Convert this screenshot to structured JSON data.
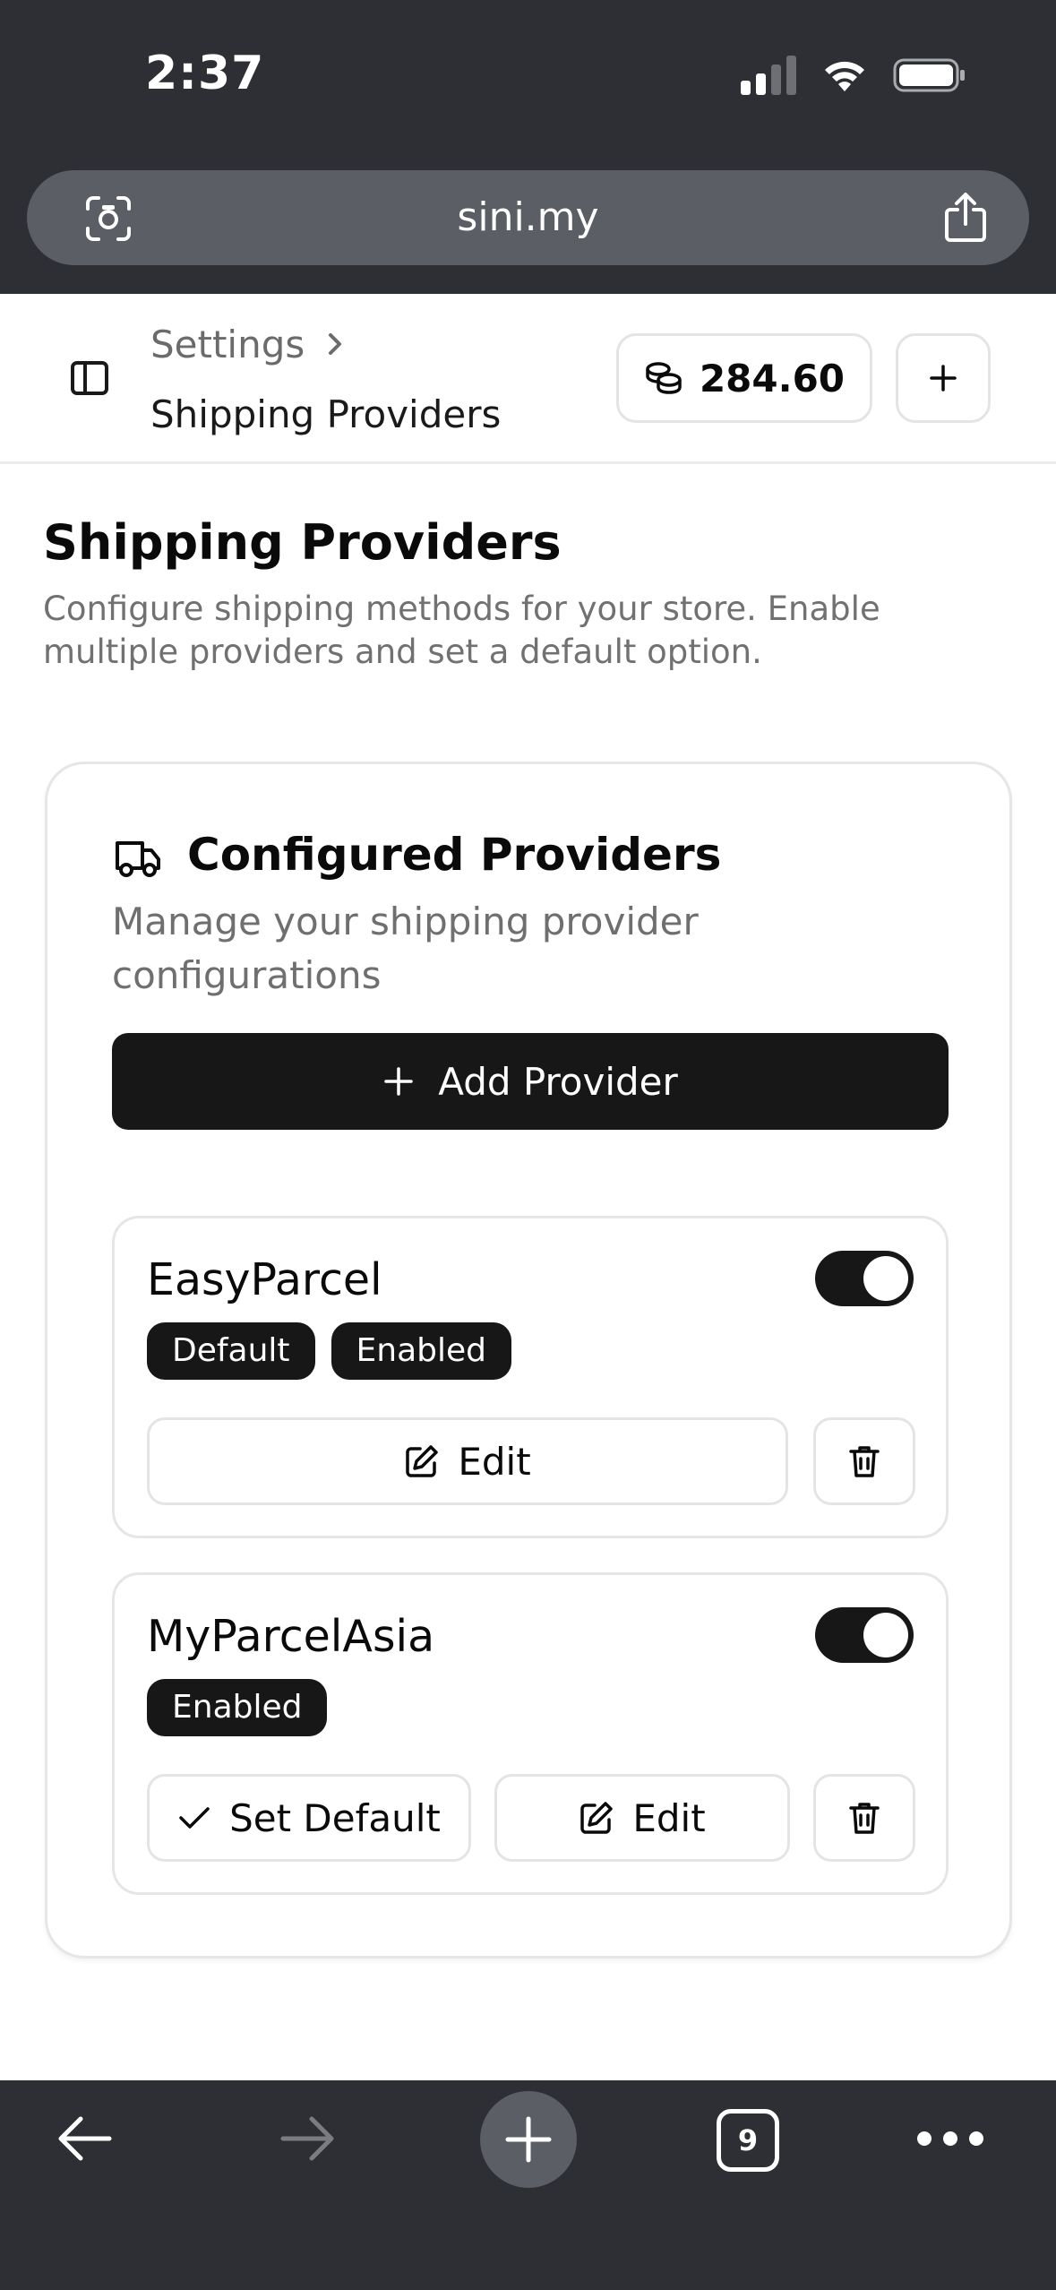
{
  "status_bar": {
    "time": "2:37"
  },
  "browser": {
    "url": "sini.my",
    "tab_count": "9"
  },
  "header": {
    "breadcrumb_parent": "Settings",
    "breadcrumb_current": "Shipping Providers",
    "credits": "284.60"
  },
  "page": {
    "title": "Shipping Providers",
    "description": "Configure shipping methods for your store. Enable multiple providers and set a default option."
  },
  "card": {
    "title": "Configured Providers",
    "description": "Manage your shipping provider configurations",
    "add_button": "Add Provider"
  },
  "providers": [
    {
      "name": "EasyParcel",
      "enabled": true,
      "badges": [
        "Default",
        "Enabled"
      ],
      "edit_label": "Edit"
    },
    {
      "name": "MyParcelAsia",
      "enabled": true,
      "badges": [
        "Enabled"
      ],
      "set_default_label": "Set Default",
      "edit_label": "Edit"
    }
  ],
  "icons": {
    "url_left": "camera-scan-icon",
    "url_right": "share-icon",
    "sidebar": "sidebar-toggle-icon",
    "credits": "coins-icon",
    "card": "truck-icon",
    "edit": "edit-icon",
    "delete": "trash-icon",
    "check": "check-icon"
  },
  "colors": {
    "primary": "#171717",
    "chrome": "#2d2f34",
    "muted_text": "#717171"
  }
}
